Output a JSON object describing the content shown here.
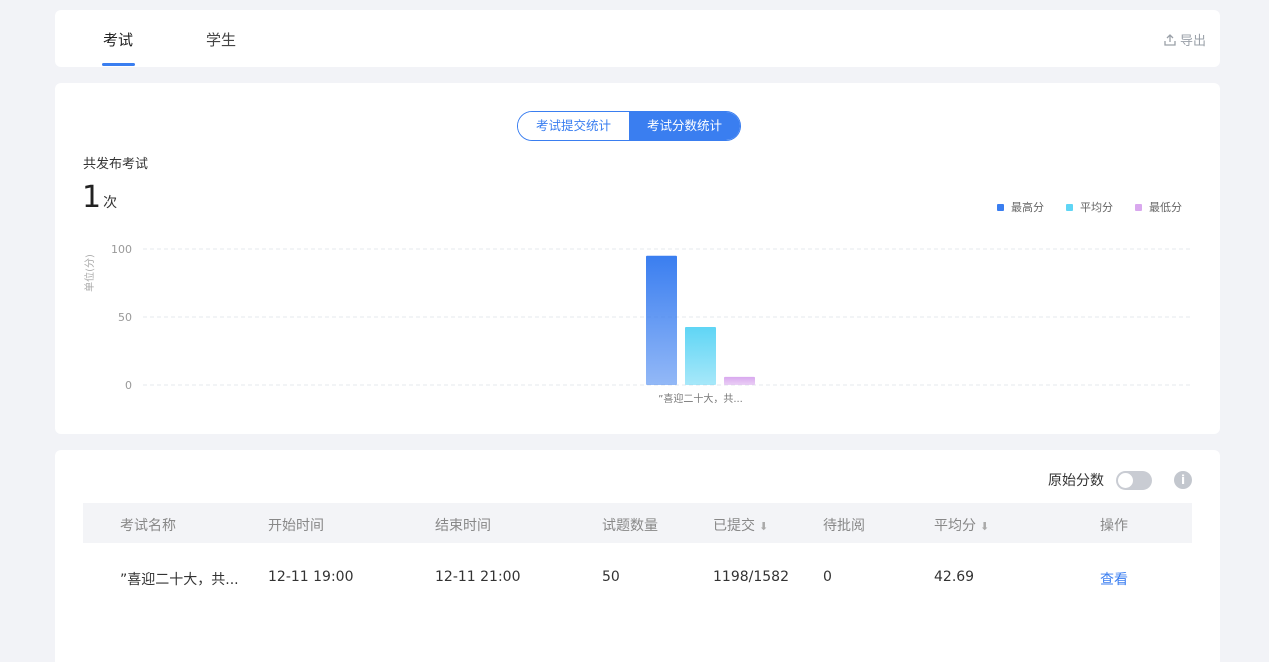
{
  "tabs": [
    {
      "label": "考试",
      "active": true
    },
    {
      "label": "学生",
      "active": false
    }
  ],
  "export_label": "导出",
  "icons": {
    "export": "upload-icon",
    "info": "info-icon",
    "sort": "arrow-down-icon"
  },
  "stats": {
    "toggle": [
      "考试提交统计",
      "考试分数统计"
    ],
    "active_toggle": 1,
    "published_label": "共发布考试",
    "published_count": "1",
    "published_unit": "次"
  },
  "colors": {
    "accent": "#3a7ef0",
    "max": "#3a7ef0",
    "avg": "#5fd5f5",
    "min": "#d9a8ee"
  },
  "chart_data": {
    "type": "bar",
    "categories": [
      "”喜迎二十大，共..."
    ],
    "series": [
      {
        "name": "最高分",
        "values": [
          95
        ]
      },
      {
        "name": "平均分",
        "values": [
          42.69
        ]
      },
      {
        "name": "最低分",
        "values": [
          6
        ]
      }
    ],
    "ylabel": "单位(分)",
    "yticks": [
      0,
      50,
      100
    ],
    "ylim": [
      0,
      100
    ],
    "grid": true,
    "legend_position": "top-right"
  },
  "table": {
    "raw_score_label": "原始分数",
    "raw_score_on": false,
    "headers": [
      "考试名称",
      "开始时间",
      "结束时间",
      "试题数量",
      "已提交",
      "待批阅",
      "平均分",
      "操作"
    ],
    "rows": [
      [
        "”喜迎二十大，共...",
        "12-11 19:00",
        "12-11 21:00",
        "50",
        "1198/1582",
        "0",
        "42.69",
        "查看"
      ]
    ]
  }
}
